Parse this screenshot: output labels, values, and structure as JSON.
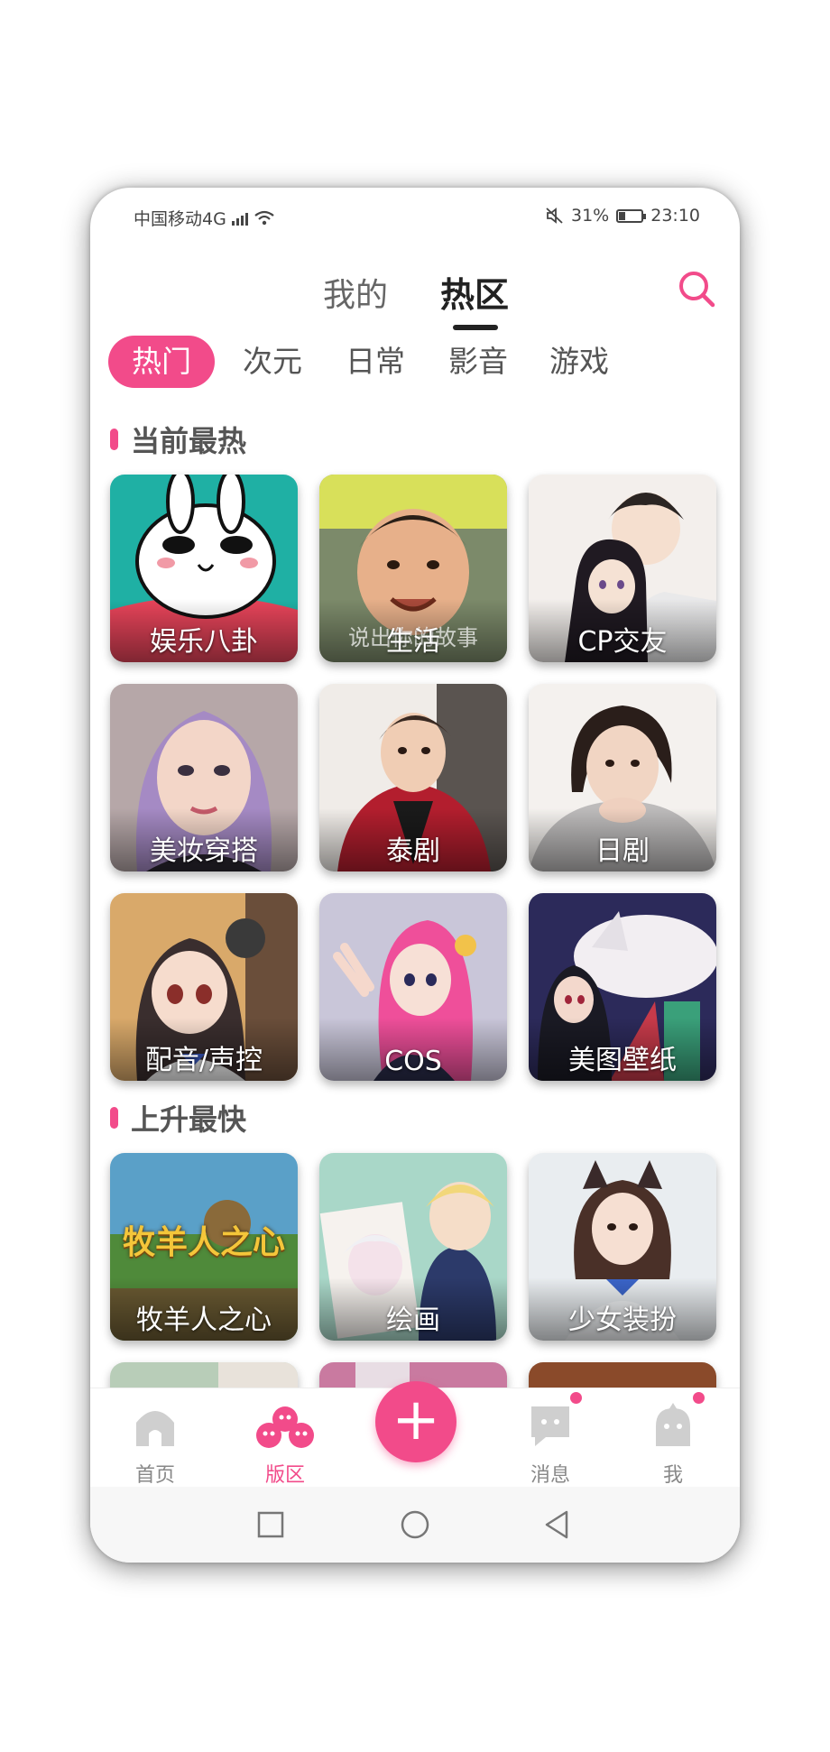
{
  "status_bar": {
    "carrier": "中国移动4G",
    "network_superscript": "4G",
    "battery_percent": "31%",
    "battery_level": 0.31,
    "time": "23:10"
  },
  "header": {
    "tabs": [
      {
        "label": "我的",
        "active": false
      },
      {
        "label": "热区",
        "active": true
      }
    ],
    "search_icon": "search-icon"
  },
  "categories": [
    {
      "label": "热门",
      "active": true
    },
    {
      "label": "次元",
      "active": false
    },
    {
      "label": "日常",
      "active": false
    },
    {
      "label": "影音",
      "active": false
    },
    {
      "label": "游戏",
      "active": false
    }
  ],
  "sections": [
    {
      "title": "当前最热",
      "tiles": [
        {
          "label": "娱乐八卦"
        },
        {
          "label": "生活",
          "overlay_text": "说出你的故事"
        },
        {
          "label": "CP交友"
        },
        {
          "label": "美妆穿搭"
        },
        {
          "label": "泰剧"
        },
        {
          "label": "日剧"
        },
        {
          "label": "配音/声控"
        },
        {
          "label": "COS"
        },
        {
          "label": "美图壁纸"
        }
      ]
    },
    {
      "title": "上升最快",
      "tiles": [
        {
          "label": "牧羊人之心",
          "overlay_text": "牧羊人之心"
        },
        {
          "label": "绘画"
        },
        {
          "label": "少女装扮"
        }
      ]
    }
  ],
  "bottom_nav": {
    "items": [
      {
        "label": "首页",
        "icon": "home-icon",
        "active": false
      },
      {
        "label": "版区",
        "icon": "board-icon",
        "active": true
      },
      {
        "label": "",
        "icon": "plus-icon",
        "active": false
      },
      {
        "label": "消息",
        "icon": "message-icon",
        "active": false,
        "badge": true
      },
      {
        "label": "我",
        "icon": "profile-icon",
        "active": false,
        "badge": true
      }
    ]
  },
  "colors": {
    "accent": "#f24b8a",
    "text_dark": "#222222",
    "text_muted": "#555555"
  }
}
